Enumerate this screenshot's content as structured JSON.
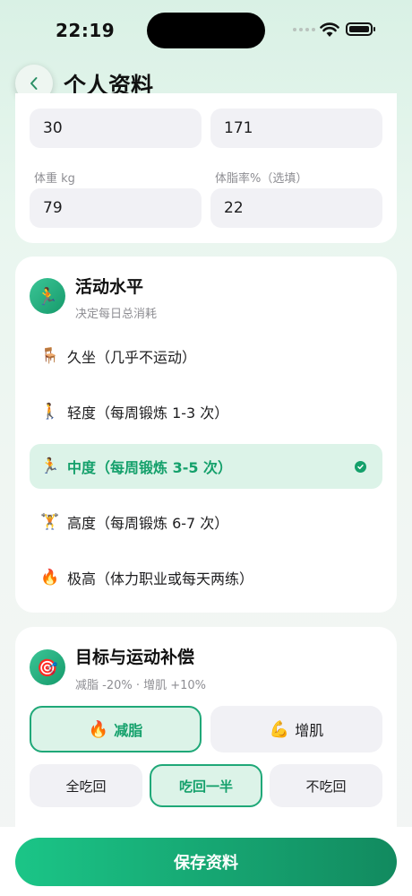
{
  "status_bar": {
    "time": "22:19"
  },
  "header": {
    "title": "个人资料"
  },
  "body_metrics": {
    "age_value": "30",
    "height_value": "171",
    "weight_label": "体重 kg",
    "weight_value": "79",
    "bodyfat_label": "体脂率%（选填）",
    "bodyfat_value": "22"
  },
  "activity": {
    "icon": "🏃",
    "title": "活动水平",
    "subtitle": "决定每日总消耗",
    "options": [
      {
        "emoji": "🪑",
        "label": "久坐（几乎不运动）",
        "selected": false
      },
      {
        "emoji": "🚶",
        "label": "轻度（每周锻炼 1-3 次）",
        "selected": false
      },
      {
        "emoji": "🏃",
        "label": "中度（每周锻炼 3-5 次）",
        "selected": true
      },
      {
        "emoji": "🏋️",
        "label": "高度（每周锻炼 6-7 次）",
        "selected": false
      },
      {
        "emoji": "🔥",
        "label": "极高（体力职业或每天两练）",
        "selected": false
      }
    ]
  },
  "goal": {
    "icon": "🎯",
    "title": "目标与运动补偿",
    "subtitle": "减脂 -20% · 增肌 +10%",
    "goals": [
      {
        "emoji": "🔥",
        "label": "减脂",
        "selected": true
      },
      {
        "emoji": "💪",
        "label": "增肌",
        "selected": false
      }
    ],
    "compensation": [
      {
        "label": "全吃回",
        "selected": false
      },
      {
        "label": "吃回一半",
        "selected": true
      },
      {
        "label": "不吃回",
        "selected": false
      }
    ]
  },
  "footer": {
    "save_label": "保存资料"
  },
  "colors": {
    "accent": "#14a06b",
    "accent_light": "#dcf3e8",
    "input_bg": "#f1f1f5"
  }
}
